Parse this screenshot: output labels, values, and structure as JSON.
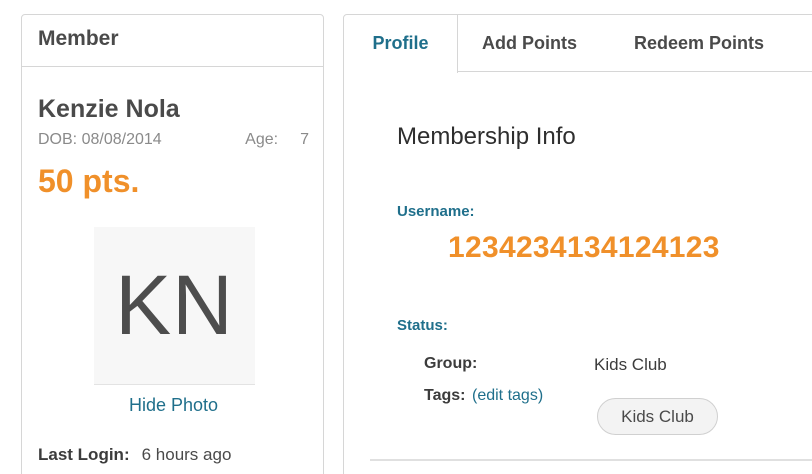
{
  "member_card": {
    "header": "Member",
    "name": "Kenzie Nola",
    "dob_label": "DOB:",
    "dob": "08/08/2014",
    "age_label": "Age:",
    "age": "7",
    "points": "50 pts.",
    "initials": "KN",
    "hide_photo_label": "Hide Photo",
    "last_login_label": "Last Login:",
    "last_login": "6 hours ago"
  },
  "tabs": [
    {
      "label": "Profile",
      "active": true
    },
    {
      "label": "Add Points",
      "active": false
    },
    {
      "label": "Redeem Points",
      "active": false
    }
  ],
  "membership": {
    "title": "Membership Info",
    "username_label": "Username:",
    "username": "1234234134124123",
    "status_label": "Status:",
    "group_label": "Group:",
    "group": "Kids Club",
    "tags_label": "Tags:",
    "edit_tags_label": "(edit tags)",
    "tags": [
      "Kids Club"
    ]
  },
  "colors": {
    "accent_orange": "#f0902a",
    "link_teal": "#1f6f8b",
    "border": "#d6d6d6"
  }
}
